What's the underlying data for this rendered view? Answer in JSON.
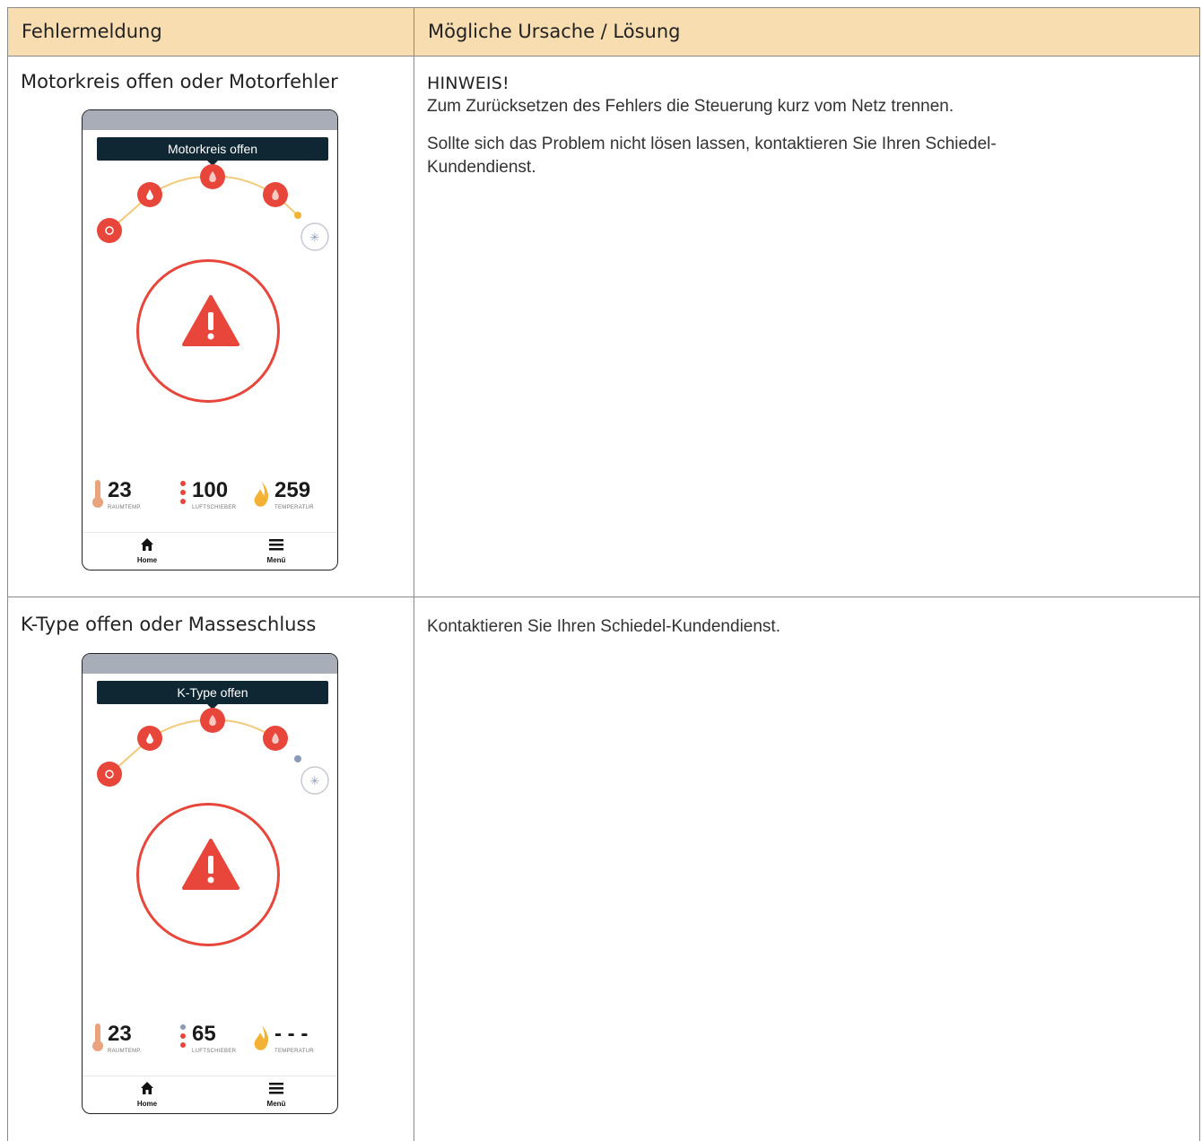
{
  "header": {
    "col1": "Fehlermeldung",
    "col2": "Mögliche Ursache / Lösung"
  },
  "rows": [
    {
      "error": "Motorkreis offen oder Motorfehler",
      "hint_title": "HINWEIS!",
      "paragraphs": [
        "Zum Zurücksetzen des Fehlers die Steuerung kurz vom Netz trennen.",
        "Sollte sich das Problem nicht lösen lassen, kontaktieren Sie Ihren Schiedel-Kundendienst."
      ],
      "phone": {
        "banner": "Motorkreis offen",
        "stats": [
          {
            "value": "23",
            "label": "RAUMTEMP."
          },
          {
            "value": "100",
            "label": "LUFTSCHIEBER"
          },
          {
            "value": "259",
            "label": "TEMPERATUR"
          }
        ],
        "nav": {
          "home": "Home",
          "menu": "Menü"
        }
      }
    },
    {
      "error": "K-Type offen oder Masseschluss",
      "paragraphs": [
        "Kontaktieren Sie Ihren Schiedel-Kundendienst."
      ],
      "phone": {
        "banner": "K-Type offen",
        "stats": [
          {
            "value": "23",
            "label": "RAUMTEMP."
          },
          {
            "value": "65",
            "label": "LUFTSCHIEBER"
          },
          {
            "value": "- - -",
            "label": "TEMPERATUR"
          }
        ],
        "nav": {
          "home": "Home",
          "menu": "Menü"
        }
      }
    }
  ],
  "colors": {
    "header_bg": "#f8ddb1",
    "accent_red": "#e8463a",
    "banner_bg": "#0f2633",
    "flame": "#f3b233"
  }
}
